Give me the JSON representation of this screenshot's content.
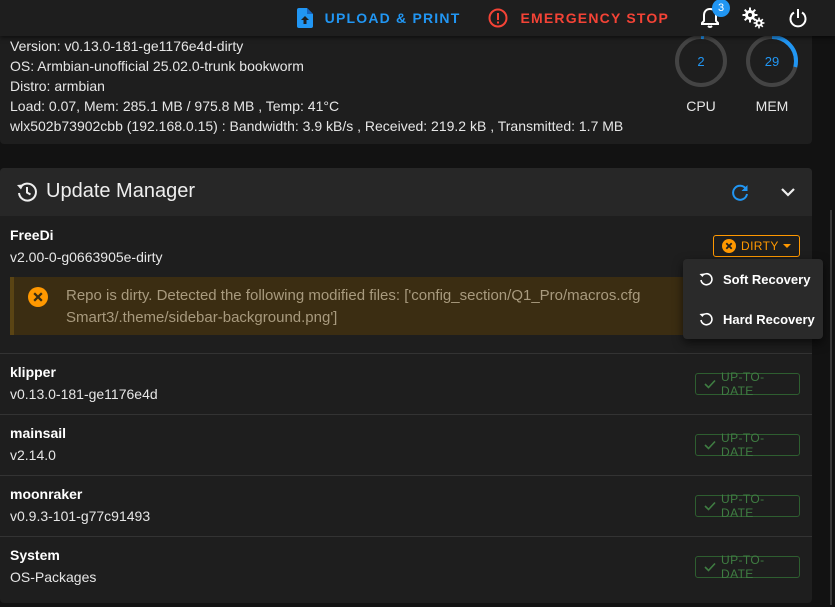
{
  "topbar": {
    "upload_label": "UPLOAD & PRINT",
    "estop_label": "EMERGENCY STOP",
    "notification_count": "3"
  },
  "system": {
    "version": "Version: v0.13.0-181-ge1176e4d-dirty",
    "os": "OS: Armbian-unofficial 25.02.0-trunk bookworm",
    "distro": "Distro: armbian",
    "load": "Load: 0.07, Mem: 285.1 MB / 975.8 MB , Temp: 41°C",
    "network": "wlx502b73902cbb (192.168.0.15) : Bandwidth: 3.9 kB/s , Received: 219.2 kB , Transmitted: 1.7 MB",
    "cpu": {
      "value": "2",
      "label": "CPU",
      "percent": 2
    },
    "mem": {
      "value": "29",
      "label": "MEM",
      "percent": 29
    }
  },
  "update_manager": {
    "title": "Update Manager",
    "items": [
      {
        "name": "FreeDi",
        "version": "v2.00-0-g0663905e-dirty",
        "status": "DIRTY"
      },
      {
        "name": "klipper",
        "version": "v0.13.0-181-ge1176e4d",
        "status": "UP-TO-DATE"
      },
      {
        "name": "mainsail",
        "version": "v2.14.0",
        "status": "UP-TO-DATE"
      },
      {
        "name": "moonraker",
        "version": "v0.9.3-101-g77c91493",
        "status": "UP-TO-DATE"
      },
      {
        "name": "System",
        "version": "OS-Packages",
        "status": "UP-TO-DATE"
      }
    ],
    "alert_line1": "Repo is dirty. Detected the following modified files: ['config_section/Q1_Pro/macros.cfg",
    "alert_line2": "Smart3/.theme/sidebar-background.png']"
  },
  "menu": {
    "soft_recovery": "Soft Recovery",
    "hard_recovery": "Hard Recovery"
  },
  "colors": {
    "accent": "#2196f3",
    "danger": "#f44336",
    "warning": "#ff9800",
    "success": "#3f7d42"
  }
}
